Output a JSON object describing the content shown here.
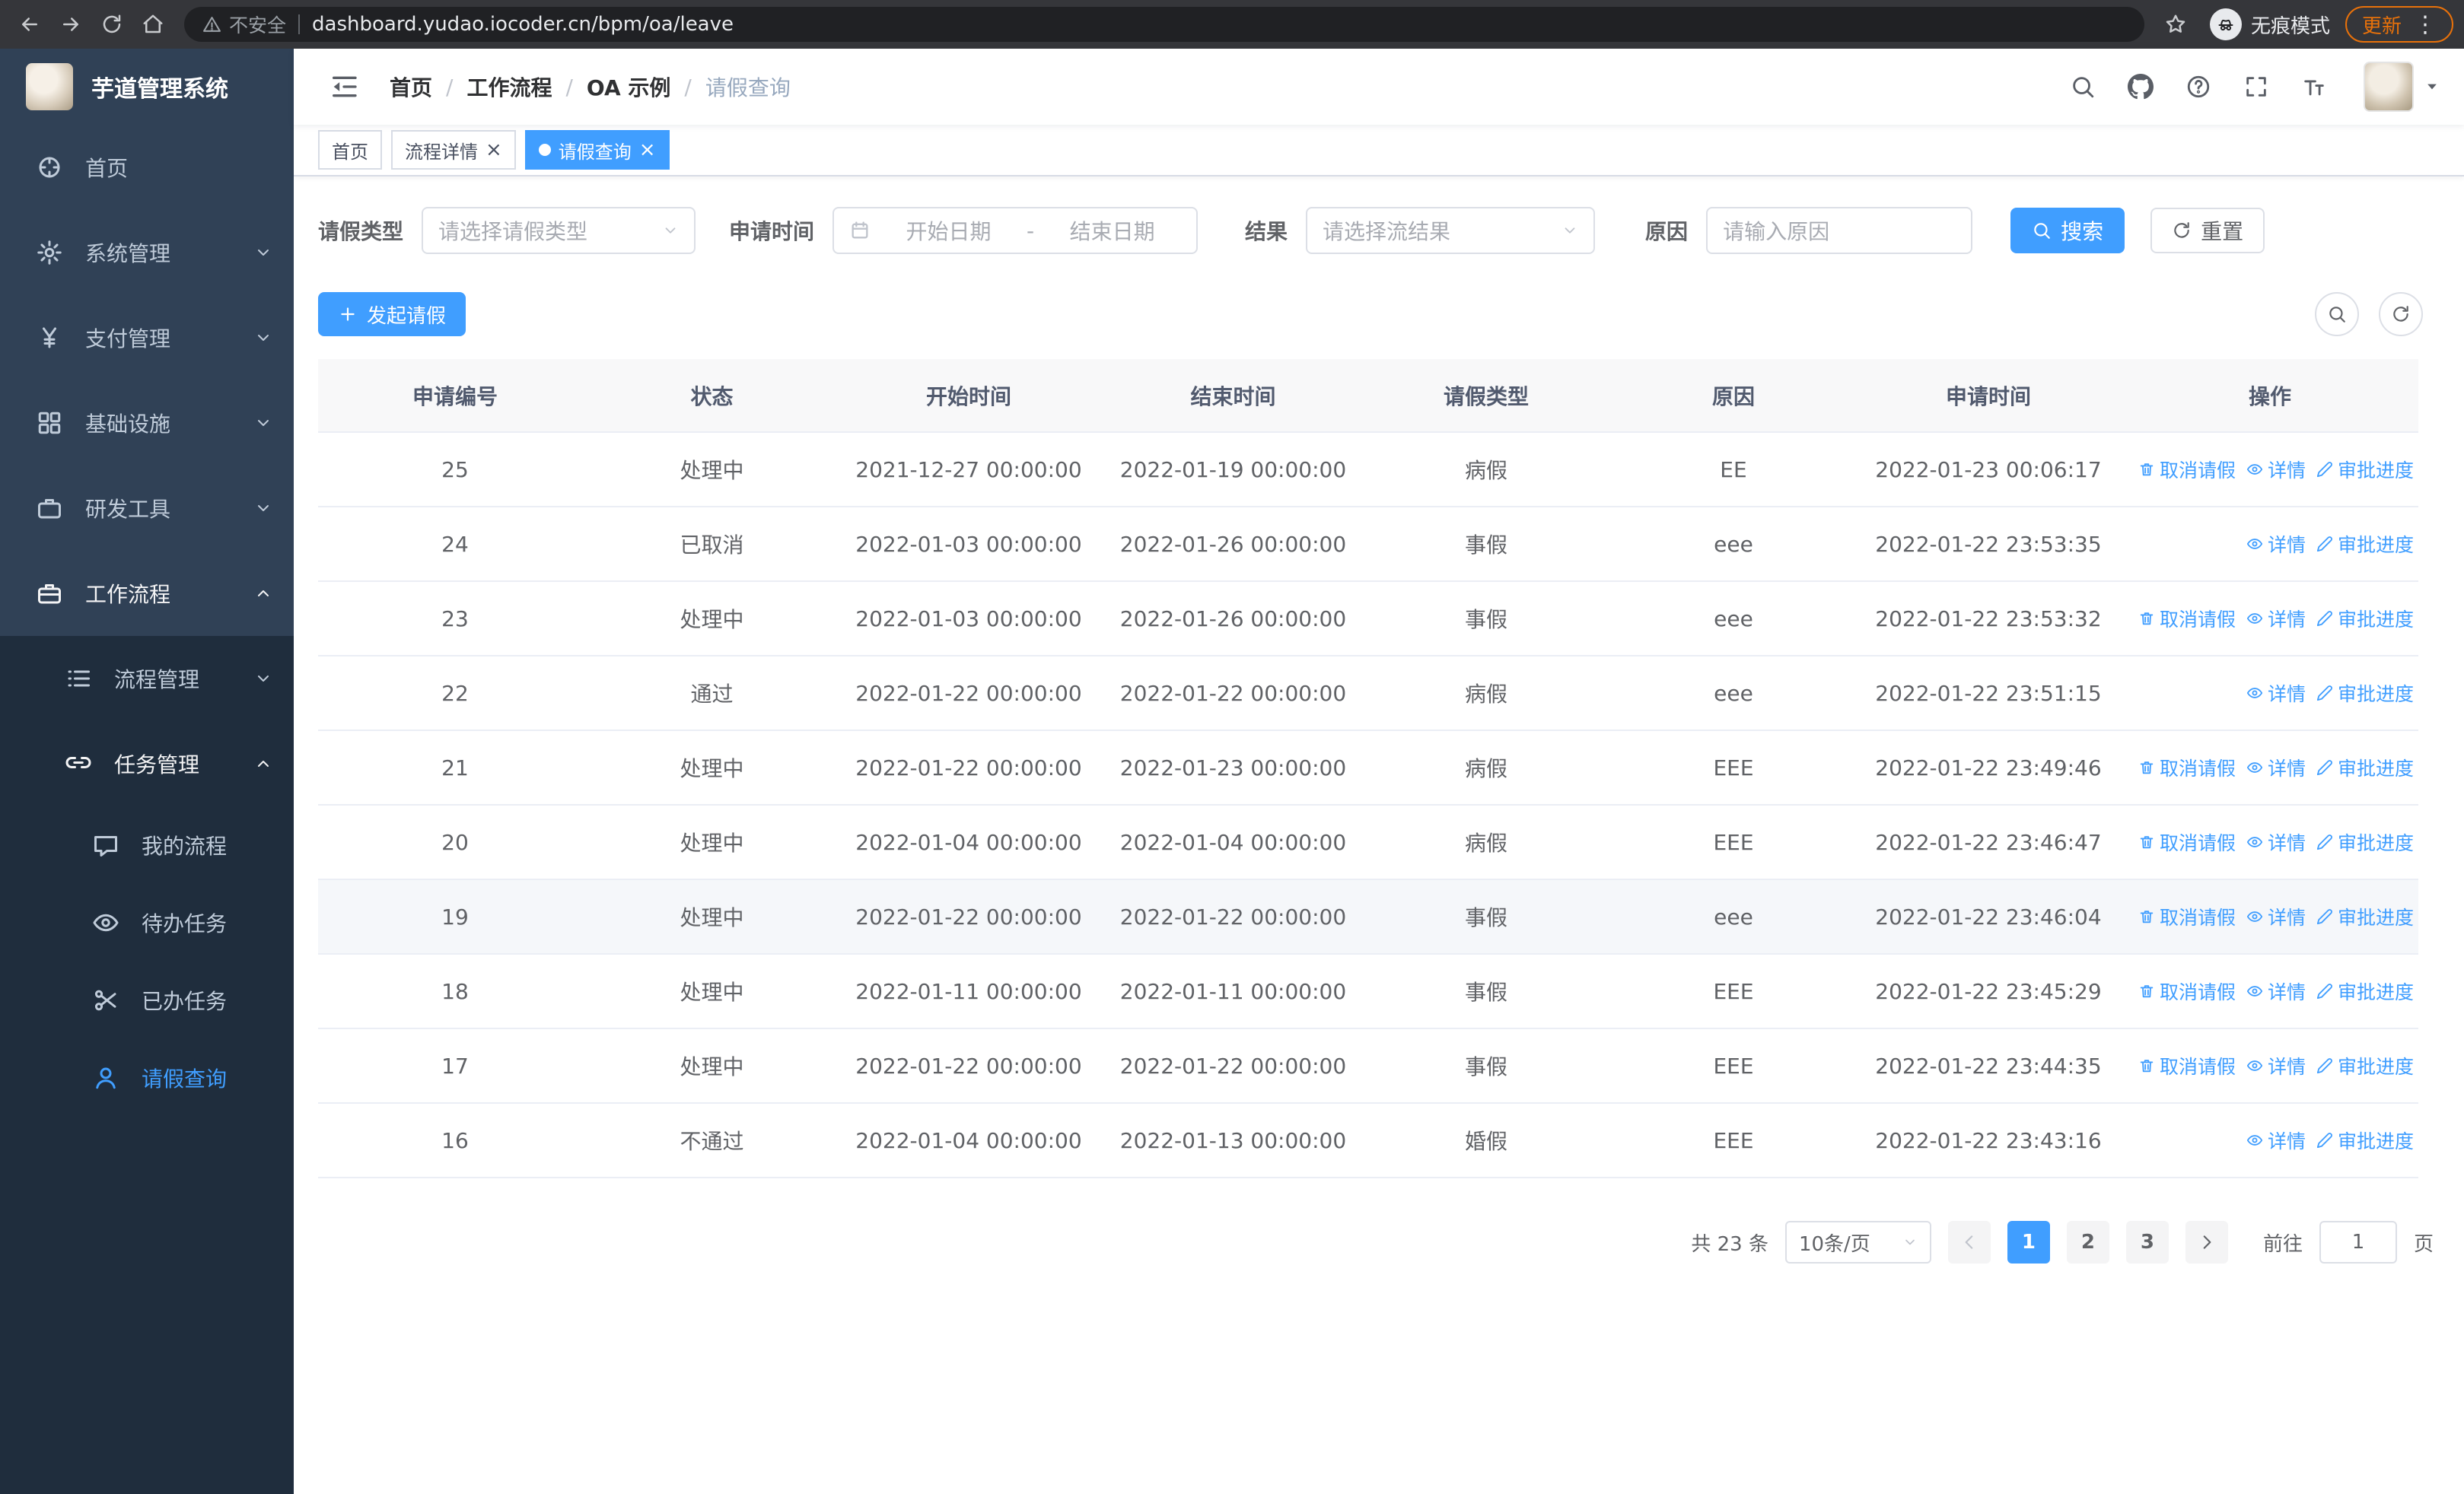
{
  "browser": {
    "security_label": "不安全",
    "url": "dashboard.yudao.iocoder.cn/bpm/oa/leave",
    "incognito_label": "无痕模式",
    "update_label": "更新"
  },
  "app_title": "芋道管理系统",
  "colors": {
    "primary": "#409EFF",
    "sidebar_bg": "#304156",
    "submenu_bg": "#1f2d3d",
    "sidebar_text": "#bfcbd9"
  },
  "sidebar": {
    "items": [
      {
        "key": "home",
        "label": "首页",
        "icon": "guide",
        "level": 1
      },
      {
        "key": "system",
        "label": "系统管理",
        "icon": "gear",
        "level": 1,
        "chevron": "down"
      },
      {
        "key": "payment",
        "label": "支付管理",
        "icon": "yen",
        "level": 1,
        "chevron": "down"
      },
      {
        "key": "infrastructure",
        "label": "基础设施",
        "icon": "infra",
        "level": 1,
        "chevron": "down"
      },
      {
        "key": "dev-tools",
        "label": "研发工具",
        "icon": "tools",
        "level": 1,
        "chevron": "down"
      },
      {
        "key": "workflow",
        "label": "工作流程",
        "icon": "workflow",
        "level": 1,
        "chevron": "up",
        "open": true
      },
      {
        "key": "process-mgmt",
        "label": "流程管理",
        "icon": "list",
        "level": 2,
        "chevron": "down"
      },
      {
        "key": "task-mgmt",
        "label": "任务管理",
        "icon": "connection",
        "level": 2,
        "chevron": "up",
        "open": true
      },
      {
        "key": "my-process",
        "label": "我的流程",
        "icon": "chat",
        "level": 3
      },
      {
        "key": "todo-tasks",
        "label": "待办任务",
        "icon": "eye",
        "level": 3
      },
      {
        "key": "done-tasks",
        "label": "已办任务",
        "icon": "scissors",
        "level": 3
      },
      {
        "key": "leave-query",
        "label": "请假查询",
        "icon": "user",
        "level": 3,
        "active": true
      }
    ]
  },
  "breadcrumb": [
    "首页",
    "工作流程",
    "OA 示例",
    "请假查询"
  ],
  "tabs": [
    {
      "label": "首页",
      "closable": false,
      "active": false
    },
    {
      "label": "流程详情",
      "closable": true,
      "active": false
    },
    {
      "label": "请假查询",
      "closable": true,
      "active": true
    }
  ],
  "filters": {
    "leave_type_label": "请假类型",
    "leave_type_placeholder": "请选择请假类型",
    "apply_time_label": "申请时间",
    "date_start_placeholder": "开始日期",
    "date_separator": "-",
    "date_end_placeholder": "结束日期",
    "result_label": "结果",
    "result_placeholder": "请选择流结果",
    "reason_label": "原因",
    "reason_placeholder": "请输入原因",
    "search_label": "搜索",
    "reset_label": "重置"
  },
  "toolbar": {
    "create_label": "发起请假"
  },
  "table": {
    "columns": [
      "申请编号",
      "状态",
      "开始时间",
      "结束时间",
      "请假类型",
      "原因",
      "申请时间",
      "操作"
    ],
    "action_labels": {
      "cancel": "取消请假",
      "detail": "详情",
      "progress": "审批进度"
    },
    "rows": [
      {
        "id": "25",
        "status": "处理中",
        "start": "2021-12-27 00:00:00",
        "end": "2022-01-19 00:00:00",
        "type": "病假",
        "reason": "EE",
        "applied": "2022-01-23 00:06:17",
        "actions": [
          "cancel",
          "detail",
          "progress"
        ]
      },
      {
        "id": "24",
        "status": "已取消",
        "start": "2022-01-03 00:00:00",
        "end": "2022-01-26 00:00:00",
        "type": "事假",
        "reason": "eee",
        "applied": "2022-01-22 23:53:35",
        "actions": [
          "detail",
          "progress"
        ]
      },
      {
        "id": "23",
        "status": "处理中",
        "start": "2022-01-03 00:00:00",
        "end": "2022-01-26 00:00:00",
        "type": "事假",
        "reason": "eee",
        "applied": "2022-01-22 23:53:32",
        "actions": [
          "cancel",
          "detail",
          "progress"
        ]
      },
      {
        "id": "22",
        "status": "通过",
        "start": "2022-01-22 00:00:00",
        "end": "2022-01-22 00:00:00",
        "type": "病假",
        "reason": "eee",
        "applied": "2022-01-22 23:51:15",
        "actions": [
          "detail",
          "progress"
        ]
      },
      {
        "id": "21",
        "status": "处理中",
        "start": "2022-01-22 00:00:00",
        "end": "2022-01-23 00:00:00",
        "type": "病假",
        "reason": "EEE",
        "applied": "2022-01-22 23:49:46",
        "actions": [
          "cancel",
          "detail",
          "progress"
        ]
      },
      {
        "id": "20",
        "status": "处理中",
        "start": "2022-01-04 00:00:00",
        "end": "2022-01-04 00:00:00",
        "type": "病假",
        "reason": "EEE",
        "applied": "2022-01-22 23:46:47",
        "actions": [
          "cancel",
          "detail",
          "progress"
        ]
      },
      {
        "id": "19",
        "status": "处理中",
        "start": "2022-01-22 00:00:00",
        "end": "2022-01-22 00:00:00",
        "type": "事假",
        "reason": "eee",
        "applied": "2022-01-22 23:46:04",
        "actions": [
          "cancel",
          "detail",
          "progress"
        ],
        "highlighted": true
      },
      {
        "id": "18",
        "status": "处理中",
        "start": "2022-01-11 00:00:00",
        "end": "2022-01-11 00:00:00",
        "type": "事假",
        "reason": "EEE",
        "applied": "2022-01-22 23:45:29",
        "actions": [
          "cancel",
          "detail",
          "progress"
        ]
      },
      {
        "id": "17",
        "status": "处理中",
        "start": "2022-01-22 00:00:00",
        "end": "2022-01-22 00:00:00",
        "type": "事假",
        "reason": "EEE",
        "applied": "2022-01-22 23:44:35",
        "actions": [
          "cancel",
          "detail",
          "progress"
        ]
      },
      {
        "id": "16",
        "status": "不通过",
        "start": "2022-01-04 00:00:00",
        "end": "2022-01-13 00:00:00",
        "type": "婚假",
        "reason": "EEE",
        "applied": "2022-01-22 23:43:16",
        "actions": [
          "detail",
          "progress"
        ]
      }
    ]
  },
  "pagination": {
    "total_label": "共 23 条",
    "page_size_label": "10条/页",
    "pages": [
      "1",
      "2",
      "3"
    ],
    "active_page": "1",
    "goto_label": "前往",
    "goto_value": "1",
    "goto_suffix_label": "页"
  }
}
